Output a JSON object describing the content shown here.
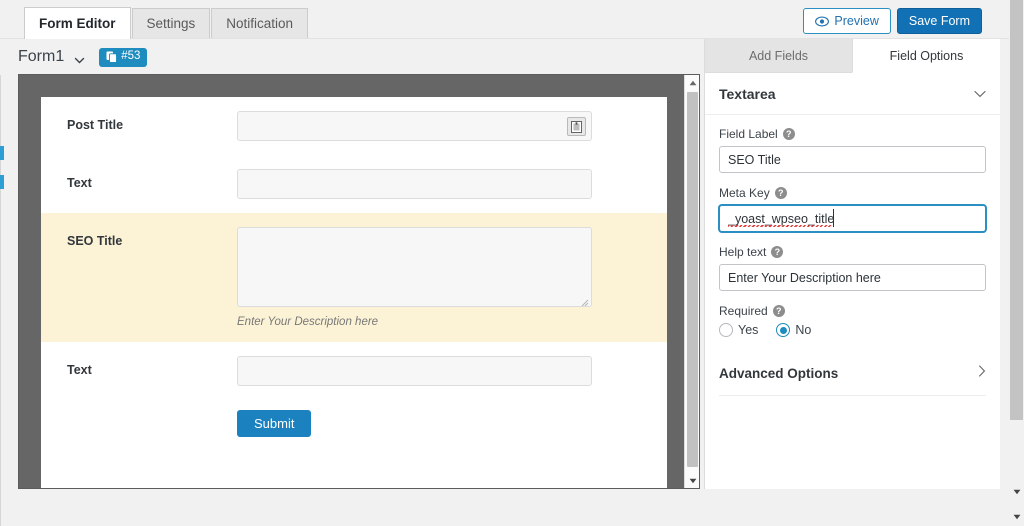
{
  "window": {
    "topbar_tabs": [
      {
        "label": "Form Editor",
        "active": true
      },
      {
        "label": "Settings",
        "active": false
      },
      {
        "label": "Notification",
        "active": false
      }
    ],
    "actions": {
      "preview_label": "Preview",
      "preview_icon": "eye-icon",
      "save_label": "Save Form"
    }
  },
  "form_header": {
    "name": "Form1",
    "dropdown_icon": "chevron-down-icon",
    "badge_icon": "copy-icon",
    "badge_label": "#53"
  },
  "canvas": {
    "rows": [
      {
        "label": "Post Title",
        "control": "input",
        "value": "",
        "has_inline_button": true,
        "inline_button_icon": "calendar-icon",
        "highlighted": false,
        "help": ""
      },
      {
        "label": "Text",
        "control": "input",
        "value": "",
        "has_inline_button": false,
        "highlighted": false,
        "help": ""
      },
      {
        "label": "SEO Title",
        "control": "textarea",
        "value": "",
        "has_inline_button": false,
        "highlighted": true,
        "help": "Enter Your Description here"
      },
      {
        "label": "Text",
        "control": "input",
        "value": "",
        "has_inline_button": false,
        "highlighted": false,
        "help": ""
      }
    ],
    "submit_label": "Submit",
    "scrollbar": {
      "up_icon": "triangle-up-icon",
      "down_icon": "triangle-down-icon"
    }
  },
  "right_panel": {
    "tabs": [
      {
        "label": "Add Fields",
        "active": false
      },
      {
        "label": "Field Options",
        "active": true
      }
    ],
    "section_title": "Textarea",
    "section_collapse_icon": "chevron-down-icon",
    "fields": [
      {
        "label": "Field Label",
        "help_icon": "question-mark-icon",
        "value": "SEO Title",
        "placeholder": "",
        "focused": false,
        "misspelled": false
      },
      {
        "label": "Meta Key",
        "help_icon": "question-mark-icon",
        "value": "_yoast_wpseo_title",
        "placeholder": "",
        "focused": true,
        "misspelled": true
      },
      {
        "label": "Help text",
        "help_icon": "question-mark-icon",
        "value": "Enter Your Description here",
        "placeholder": "",
        "focused": false,
        "misspelled": false
      }
    ],
    "required": {
      "label": "Required",
      "help_icon": "question-mark-icon",
      "options": [
        {
          "label": "Yes",
          "selected": false
        },
        {
          "label": "No",
          "selected": true
        }
      ]
    },
    "advanced": {
      "label": "Advanced Options",
      "icon": "chevron-right-icon"
    }
  },
  "colors": {
    "accent_blue": "#1e8cbe",
    "save_blue": "#1271b5",
    "highlight_yellow": "#fcf3d6",
    "stage_gray": "#666666",
    "spellcheck_red": "#e03a3a"
  }
}
